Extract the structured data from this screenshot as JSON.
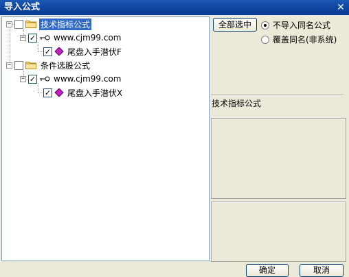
{
  "window": {
    "title": "导入公式",
    "close_label": "✕"
  },
  "tree": {
    "groups": [
      {
        "label": "技术指标公式",
        "url": "www.cjm99.com",
        "formula": "尾盘入手潜伏F"
      },
      {
        "label": "条件选股公式",
        "url": "www.cjm99.com",
        "formula": "尾盘入手潜伏X"
      }
    ]
  },
  "options": {
    "select_all_label": "全部选中",
    "radio_no_import": "不导入同名公式",
    "radio_overwrite": "覆盖同名(非系统)",
    "selected_radio": "no_import"
  },
  "info": {
    "category_label": "技术指标公式"
  },
  "buttons": {
    "ok": "确定",
    "cancel": "取消"
  },
  "colors": {
    "titlebar": "#1046a2",
    "selection": "#316ac5",
    "dialog_bg": "#ece9d8"
  }
}
